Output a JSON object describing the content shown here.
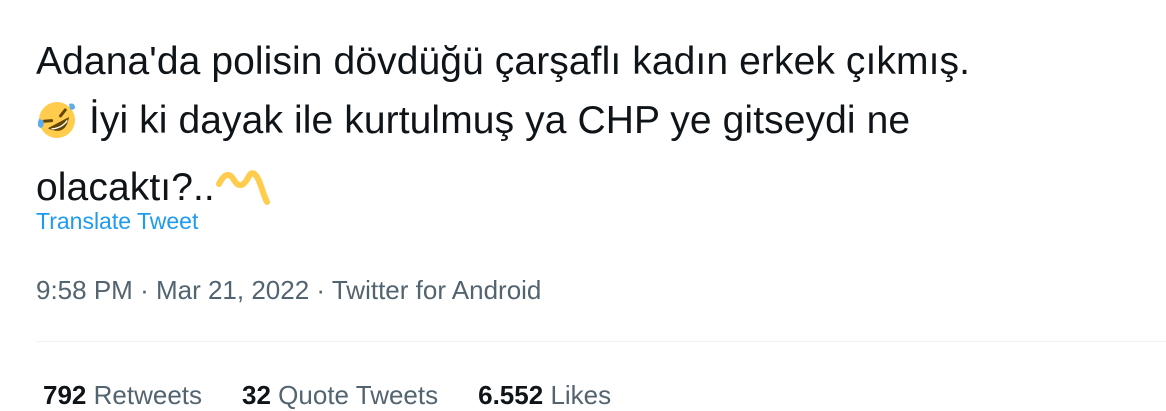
{
  "tweet": {
    "line1": "Adana'da polisin dövdüğü çarşaflı kadın erkek çıkmış.",
    "line2": "İyi ki dayak ile kurtulmuş ya CHP ye gitseydi ne",
    "line3": "olacaktı?..",
    "emoji1": "rolling-on-floor-laughing-emoji",
    "emoji2": "ok-hand-sign-emoji"
  },
  "translate_label": "Translate Tweet",
  "meta": {
    "time": "9:58 PM",
    "separator": "·",
    "date": "Mar 21, 2022",
    "source": "Twitter for Android"
  },
  "stats": {
    "retweets_count": "792",
    "retweets_label": "Retweets",
    "quotes_count": "32",
    "quotes_label": "Quote Tweets",
    "likes_count": "6.552",
    "likes_label": "Likes"
  },
  "colors": {
    "text": "#0f1419",
    "secondary": "#536471",
    "link": "#1d9bf0",
    "divider": "#eff3f4"
  }
}
